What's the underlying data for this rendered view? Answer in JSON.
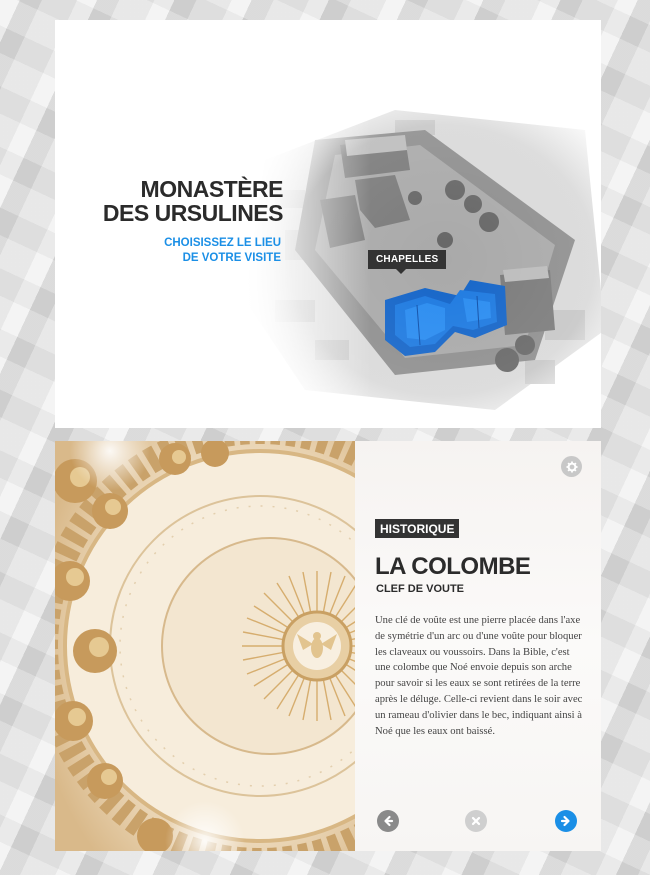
{
  "map_screen": {
    "title_lines": [
      "MONASTÈRE",
      "DES URSULINES"
    ],
    "subtitle_lines": [
      "CHOISISSEZ LE LIEU",
      "DE VOTRE VISITE"
    ],
    "highlight_label": "CHAPELLES",
    "accent_color": "#1b8fe6"
  },
  "detail_screen": {
    "category": "HISTORIQUE",
    "title": "LA COLOMBE",
    "subtitle": "CLEF DE VOUTE",
    "body": "Une clé de voûte est une pierre placée dans l'axe de symétrie d'un arc ou d'une voûte pour bloquer les claveaux ou voussoirs. Dans la Bible, c'est une colombe que Noé envoie depuis son arche pour savoir si les eaux se sont retirées de la terre après le déluge. Celle-ci revient dans le soir avec un rameau d'olivier dans le bec, indiquant ainsi à Noé que les eaux ont baissé.",
    "icons": {
      "settings": "gear-icon",
      "previous": "arrow-left-icon",
      "close": "close-icon",
      "next": "arrow-right-icon"
    }
  }
}
